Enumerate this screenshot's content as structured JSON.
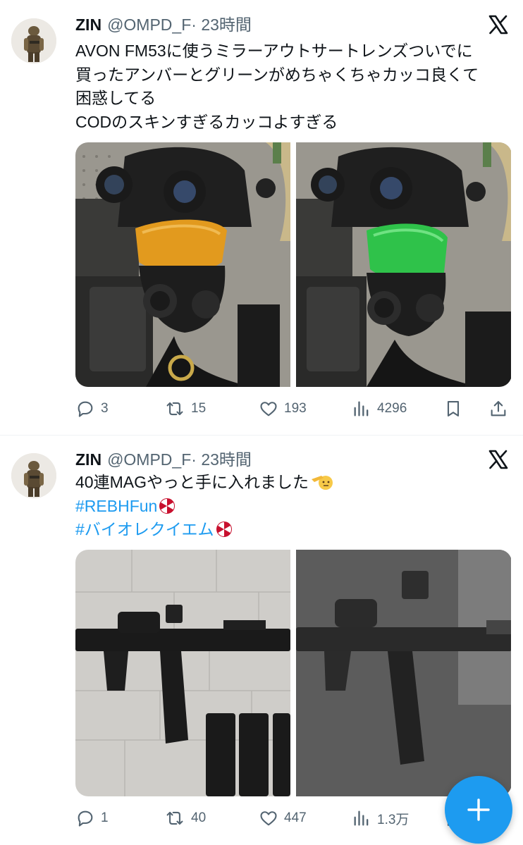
{
  "tweets": [
    {
      "name": "ZIN",
      "handle": "@OMPD_F",
      "time": "· 23時間",
      "text_lines": [
        "AVON FM53に使うミラーアウトサートレンズついでに",
        "買ったアンバーとグリーンがめちゃくちゃカッコ良くて",
        "困惑してる",
        "CODのスキンすぎるカッコよすぎる"
      ],
      "media": [
        {
          "description_icon": "photo-gas-mask-amber-lens",
          "lens_color": "#e29a1e"
        },
        {
          "description_icon": "photo-gas-mask-green-lens",
          "lens_color": "#2fc24a"
        }
      ],
      "stats": {
        "replies": "3",
        "reposts": "15",
        "likes": "193",
        "views": "4296"
      }
    },
    {
      "name": "ZIN",
      "handle": "@OMPD_F",
      "time": "· 23時間",
      "text_line": "40連MAGやっと手に入れました",
      "hashtags": [
        "#REBHFun",
        "#バイオレクイエム"
      ],
      "media": [
        {
          "description_icon": "photo-rifle-on-tiles"
        },
        {
          "description_icon": "photo-rifle-game-render"
        }
      ],
      "stats": {
        "replies": "1",
        "reposts": "40",
        "likes": "447",
        "views": "1.3万"
      }
    }
  ],
  "compose_button": {
    "icon": "plus-icon",
    "color": "#1d9bf0"
  },
  "colors": {
    "link": "#1d9bf0",
    "muted": "#536471",
    "text": "#0f1419"
  }
}
